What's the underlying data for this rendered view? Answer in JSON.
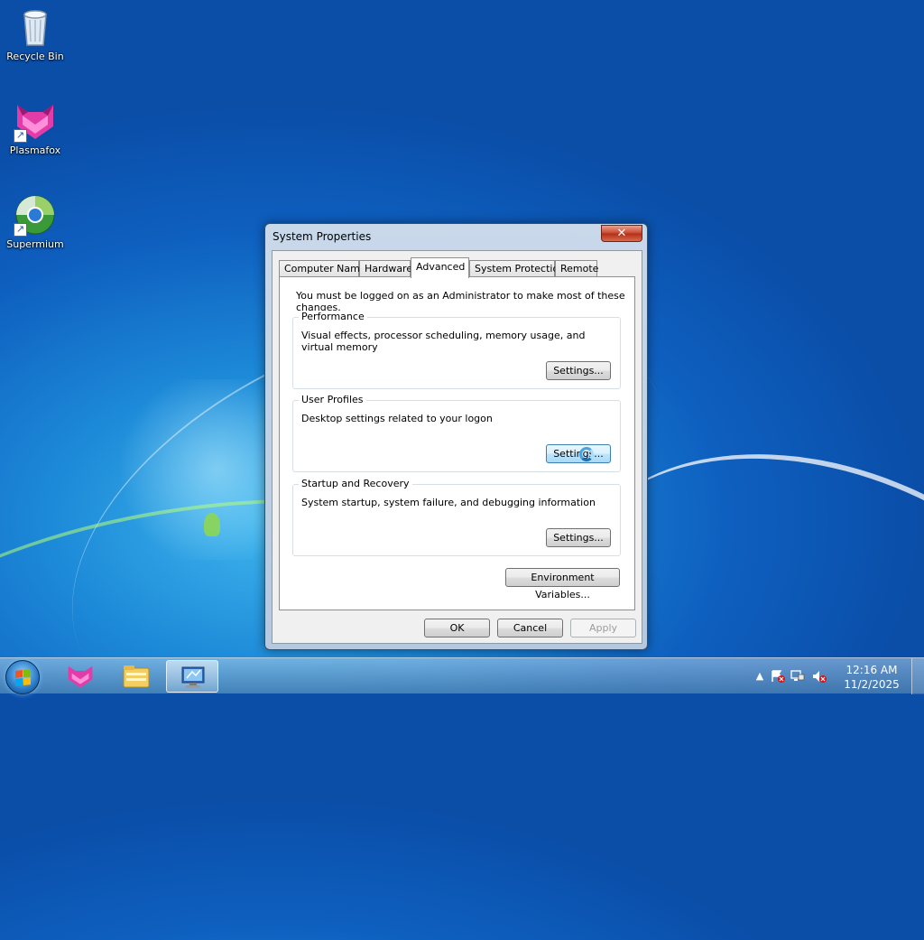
{
  "desktop": {
    "icons": [
      {
        "label": "Recycle Bin",
        "icon": "recycle-bin-icon"
      },
      {
        "label": "Plasmafox",
        "icon": "plasmafox-icon"
      },
      {
        "label": "Supermium",
        "icon": "supermium-icon"
      }
    ]
  },
  "dialog": {
    "title": "System Properties",
    "close_glyph": "✕",
    "tabs": [
      {
        "label": "Computer Name",
        "active": false
      },
      {
        "label": "Hardware",
        "active": false
      },
      {
        "label": "Advanced",
        "active": true
      },
      {
        "label": "System Protection",
        "active": false
      },
      {
        "label": "Remote",
        "active": false
      }
    ],
    "admin_note": "You must be logged on as an Administrator to make most of these changes.",
    "groups": {
      "performance": {
        "title": "Performance",
        "description": "Visual effects, processor scheduling, memory usage, and virtual memory",
        "button": "Settings..."
      },
      "user_profiles": {
        "title": "User Profiles",
        "description": "Desktop settings related to your logon",
        "button": "Settings..."
      },
      "startup_recovery": {
        "title": "Startup and Recovery",
        "description": "System startup, system failure, and debugging information",
        "button": "Settings..."
      }
    },
    "env_button": "Environment Variables...",
    "ok": "OK",
    "cancel": "Cancel",
    "apply": "Apply"
  },
  "taskbar": {
    "start_icon": "windows-start-icon",
    "pinned": [
      {
        "icon": "plasmafox-icon",
        "active": false
      },
      {
        "icon": "file-explorer-icon",
        "active": false
      },
      {
        "icon": "system-properties-icon",
        "active": true
      }
    ],
    "tray": {
      "show_hidden_glyph": "▲",
      "time": "12:16 AM",
      "date": "11/2/2025"
    }
  },
  "colors": {
    "desktop_blue": "#0e5fbf",
    "close_red": "#c8452c",
    "hover_blue": "#bee6fd"
  }
}
